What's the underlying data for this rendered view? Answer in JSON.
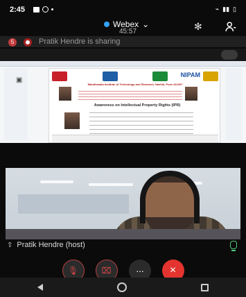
{
  "status_bar": {
    "time": "2:45",
    "icons": [
      "image-icon",
      "whatsapp-icon",
      "dot-icon",
      "wifi-icon",
      "signal-icon",
      "battery-icon"
    ]
  },
  "header": {
    "title": "Webex",
    "timer": "45:57",
    "icons": [
      "webex-icon",
      "bluetooth-icon",
      "participants-icon"
    ]
  },
  "share": {
    "badge_count": "5",
    "banner_text": "Pratik Hendre is sharing",
    "poster": {
      "brand": "NIPAM",
      "institute": "Marathwada Institute of Technology and Research, Nashik, Pune 411007",
      "event": "Awareness on Intellectual Property Rights (IPR)"
    }
  },
  "video": {
    "participant_label": "Pratik Hendre (host)"
  },
  "controls": {
    "mute_icon": "mic-off-icon",
    "video_icon": "camera-off-icon",
    "more_icon": "more-icon",
    "end_icon": "end-call-icon",
    "more_label": "···",
    "end_label": "×"
  },
  "navigation": {
    "back": "back-icon",
    "home": "home-icon",
    "recent": "recent-icon"
  }
}
